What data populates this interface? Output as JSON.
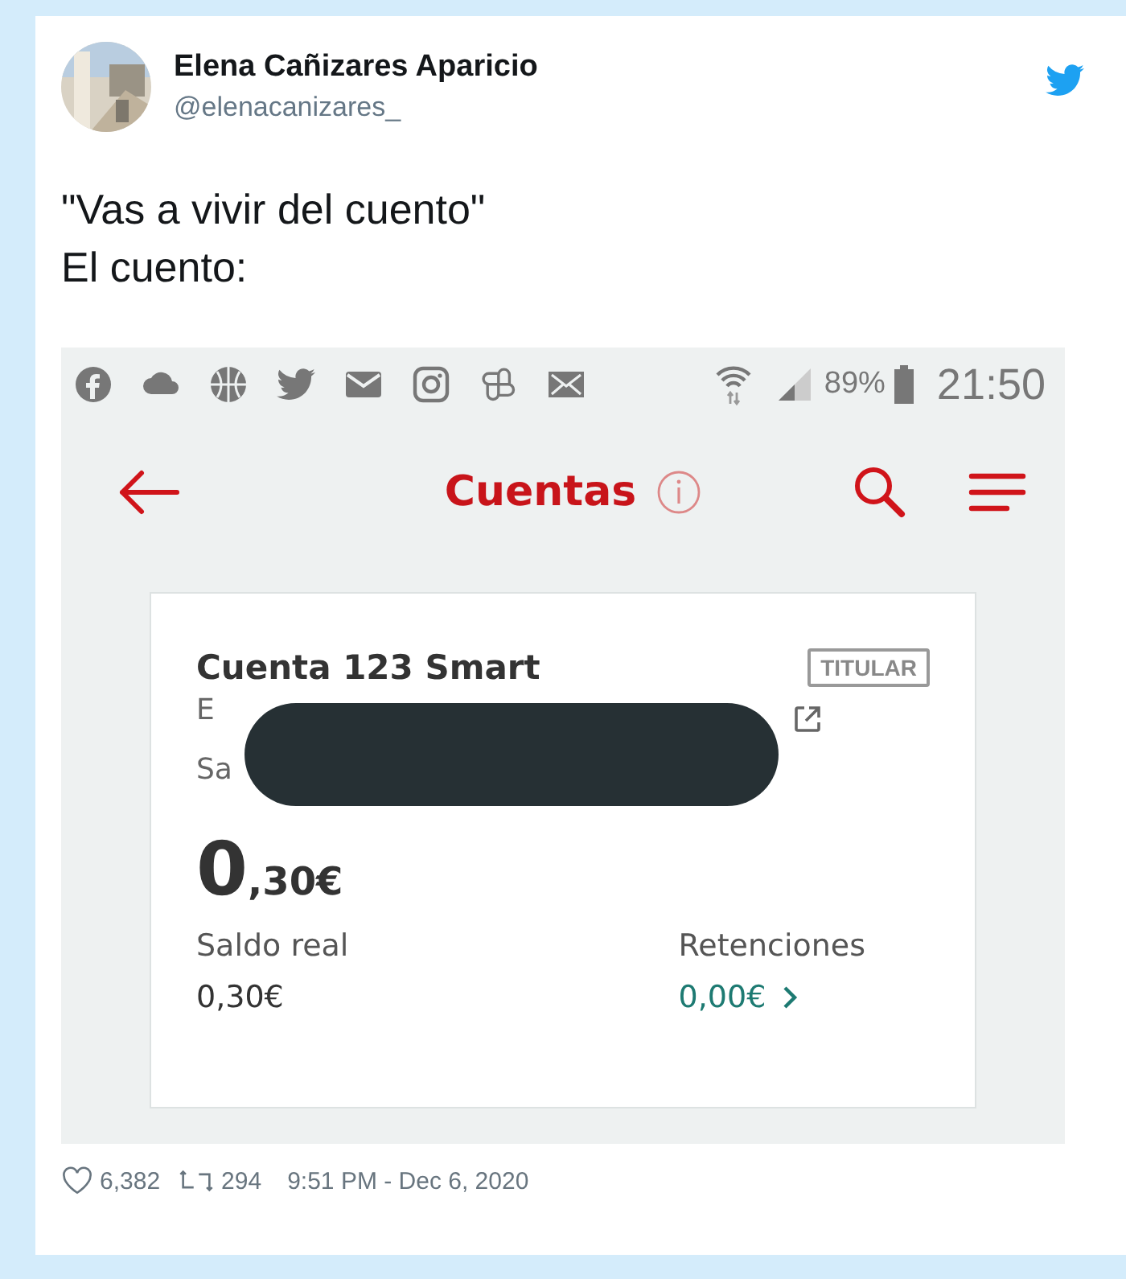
{
  "tweet": {
    "author": {
      "name": "Elena Cañizares Aparicio",
      "handle": "@elenacanizares_"
    },
    "text_lines": [
      "\"Vas a vivir del cuento\"",
      "El cuento:"
    ],
    "likes": "6,382",
    "retweets": "294",
    "timestamp": "9:51 PM - Dec 6, 2020"
  },
  "phone": {
    "status_bar": {
      "battery": "89%",
      "time": "21:50"
    },
    "header": {
      "title": "Cuentas"
    },
    "account": {
      "name": "Cuenta 123 Smart",
      "badge": "TITULAR",
      "number_fragment": "E",
      "label_fragment": "Sa",
      "balance_integer": "0",
      "balance_decimals": ",30€",
      "real_label": "Saldo real",
      "real_value": "0,30€",
      "holds_label": "Retenciones",
      "holds_value": "0,00€"
    }
  }
}
